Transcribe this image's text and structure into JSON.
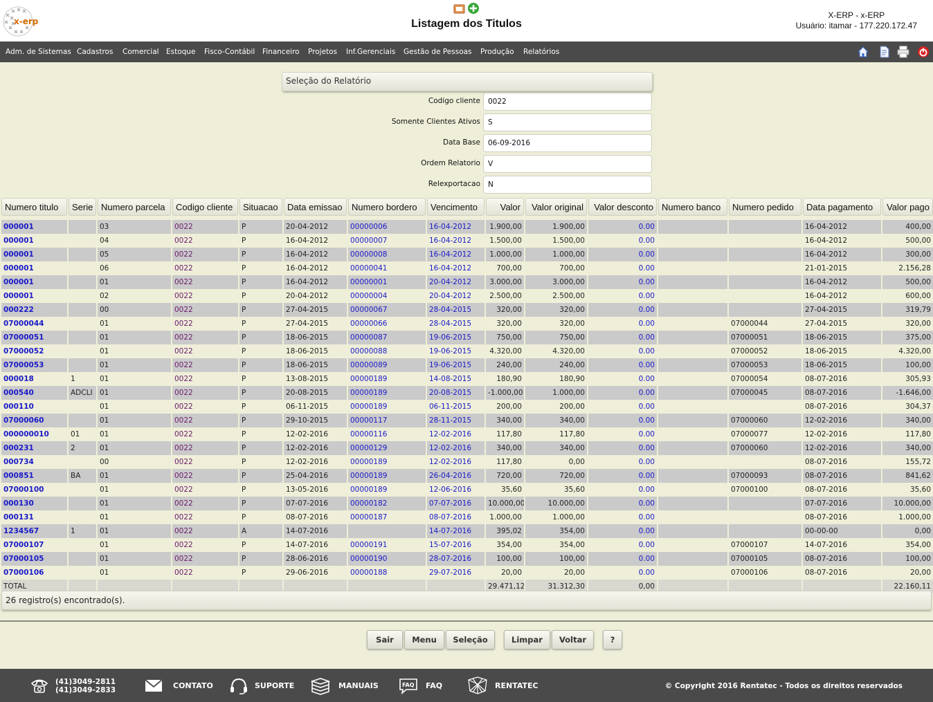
{
  "header": {
    "logo_text": "x-erp",
    "title": "Listagem dos Titulos",
    "system_name": "X-ERP - x-ERP",
    "user_info": "Usuário: itamar - 177.220.172.47"
  },
  "menu": {
    "items": [
      "Adm. de Sistemas",
      "Cadastros",
      "Comercial",
      "Estoque",
      "Fisco-Contábil",
      "Financeiro",
      "Projetos",
      "Inf.Gerenciais",
      "Gestão de Pessoas",
      "Produção",
      "Relatórios"
    ],
    "tools": [
      "home-icon",
      "document-icon",
      "printer-icon",
      "power-icon"
    ]
  },
  "selection": {
    "title": "Seleção do Relatório",
    "fields": [
      {
        "label": "Codigo cliente",
        "value": "0022"
      },
      {
        "label": "Somente Clientes Ativos",
        "value": "S"
      },
      {
        "label": "Data Base",
        "value": "06-09-2016"
      },
      {
        "label": "Ordem Relatorio",
        "value": "V"
      },
      {
        "label": "Relexportacao",
        "value": "N"
      }
    ]
  },
  "table": {
    "headers": [
      "Numero titulo",
      "Serie",
      "Numero parcela",
      "Codigo cliente",
      "Situacao",
      "Data emissao",
      "Numero bordero",
      "Vencimento",
      "Valor",
      "Valor original",
      "Valor desconto",
      "Numero banco",
      "Numero pedido",
      "Data pagamento",
      "Valor pago"
    ],
    "rows": [
      [
        "000001",
        "",
        "03",
        "0022",
        "P",
        "20-04-2012",
        "00000006",
        "16-04-2012",
        "1.900,00",
        "1.900,00",
        "0.00",
        "",
        "",
        "16-04-2012",
        "400,00"
      ],
      [
        "000001",
        "",
        "04",
        "0022",
        "P",
        "16-04-2012",
        "00000007",
        "16-04-2012",
        "1.500,00",
        "1.500,00",
        "0.00",
        "",
        "",
        "16-04-2012",
        "500,00"
      ],
      [
        "000001",
        "",
        "05",
        "0022",
        "P",
        "16-04-2012",
        "00000008",
        "16-04-2012",
        "1.000,00",
        "1.000,00",
        "0.00",
        "",
        "",
        "16-04-2012",
        "300,00"
      ],
      [
        "000001",
        "",
        "06",
        "0022",
        "P",
        "16-04-2012",
        "00000041",
        "16-04-2012",
        "700,00",
        "700,00",
        "0.00",
        "",
        "",
        "21-01-2015",
        "2.156,28"
      ],
      [
        "000001",
        "",
        "01",
        "0022",
        "P",
        "16-04-2012",
        "00000001",
        "20-04-2012",
        "3.000,00",
        "3.000,00",
        "0.00",
        "",
        "",
        "16-04-2012",
        "500,00"
      ],
      [
        "000001",
        "",
        "02",
        "0022",
        "P",
        "20-04-2012",
        "00000004",
        "20-04-2012",
        "2.500,00",
        "2.500,00",
        "0.00",
        "",
        "",
        "16-04-2012",
        "600,00"
      ],
      [
        "000222",
        "",
        "00",
        "0022",
        "P",
        "27-04-2015",
        "00000067",
        "28-04-2015",
        "320,00",
        "320,00",
        "0.00",
        "",
        "",
        "27-04-2015",
        "319,79"
      ],
      [
        "07000044",
        "",
        "01",
        "0022",
        "P",
        "27-04-2015",
        "00000066",
        "28-04-2015",
        "320,00",
        "320,00",
        "0.00",
        "",
        "07000044",
        "27-04-2015",
        "320,00"
      ],
      [
        "07000051",
        "",
        "01",
        "0022",
        "P",
        "18-06-2015",
        "00000087",
        "19-06-2015",
        "750,00",
        "750,00",
        "0.00",
        "",
        "07000051",
        "18-06-2015",
        "375,00"
      ],
      [
        "07000052",
        "",
        "01",
        "0022",
        "P",
        "18-06-2015",
        "00000088",
        "19-06-2015",
        "4.320,00",
        "4.320,00",
        "0.00",
        "",
        "07000052",
        "18-06-2015",
        "4.320,00"
      ],
      [
        "07000053",
        "",
        "01",
        "0022",
        "P",
        "18-06-2015",
        "00000089",
        "19-06-2015",
        "240,00",
        "240,00",
        "0.00",
        "",
        "07000053",
        "18-06-2015",
        "100,00"
      ],
      [
        "000018",
        "1",
        "01",
        "0022",
        "P",
        "13-08-2015",
        "00000189",
        "14-08-2015",
        "180,90",
        "180,90",
        "0.00",
        "",
        "07000054",
        "08-07-2016",
        "305,93"
      ],
      [
        "000540",
        "ADCLI",
        "01",
        "0022",
        "P",
        "20-08-2015",
        "00000189",
        "20-08-2015",
        "-1.000,00",
        "1.000,00",
        "0.00",
        "",
        "07000045",
        "08-07-2016",
        "-1.646,00"
      ],
      [
        "000110",
        "",
        "01",
        "0022",
        "P",
        "06-11-2015",
        "00000189",
        "06-11-2015",
        "200,00",
        "200,00",
        "0.00",
        "",
        "",
        "08-07-2016",
        "304,37"
      ],
      [
        "07000060",
        "",
        "01",
        "0022",
        "P",
        "29-10-2015",
        "00000117",
        "28-11-2015",
        "340,00",
        "340,00",
        "0.00",
        "",
        "07000060",
        "12-02-2016",
        "340,00"
      ],
      [
        "000000010",
        "01",
        "01",
        "0022",
        "P",
        "12-02-2016",
        "00000116",
        "12-02-2016",
        "117,80",
        "117,80",
        "0.00",
        "",
        "07000077",
        "12-02-2016",
        "117,80"
      ],
      [
        "000231",
        "2",
        "01",
        "0022",
        "P",
        "12-02-2016",
        "00000129",
        "12-02-2016",
        "340,00",
        "340,00",
        "0.00",
        "",
        "07000060",
        "12-02-2016",
        "340,00"
      ],
      [
        "000734",
        "",
        "00",
        "0022",
        "P",
        "12-02-2016",
        "00000189",
        "12-02-2016",
        "117,80",
        "0,00",
        "0.00",
        "",
        "",
        "08-07-2016",
        "155,72"
      ],
      [
        "000851",
        "BA",
        "01",
        "0022",
        "P",
        "25-04-2016",
        "00000189",
        "26-04-2016",
        "720,00",
        "720,00",
        "0.00",
        "",
        "07000093",
        "08-07-2016",
        "841,62"
      ],
      [
        "07000100",
        "",
        "01",
        "0022",
        "P",
        "13-05-2016",
        "00000189",
        "12-06-2016",
        "35,60",
        "35,60",
        "0.00",
        "",
        "07000100",
        "08-07-2016",
        "35,60"
      ],
      [
        "000130",
        "",
        "01",
        "0022",
        "P",
        "07-07-2016",
        "00000182",
        "07-07-2016",
        "10.000,00",
        "10.000,00",
        "0.00",
        "",
        "",
        "07-07-2016",
        "10.000,00"
      ],
      [
        "000131",
        "",
        "01",
        "0022",
        "P",
        "08-07-2016",
        "00000187",
        "08-07-2016",
        "1.000,00",
        "1.000,00",
        "0.00",
        "",
        "",
        "08-07-2016",
        "1.000,00"
      ],
      [
        "1234567",
        "1",
        "01",
        "0022",
        "A",
        "14-07-2016",
        "",
        "14-07-2016",
        "395,02",
        "354,00",
        "0.00",
        "",
        "",
        "00-00-00",
        "0,00"
      ],
      [
        "07000107",
        "",
        "01",
        "0022",
        "P",
        "14-07-2016",
        "00000191",
        "15-07-2016",
        "354,00",
        "354,00",
        "0.00",
        "",
        "07000107",
        "14-07-2016",
        "354,00"
      ],
      [
        "07000105",
        "",
        "01",
        "0022",
        "P",
        "28-06-2016",
        "00000190",
        "28-07-2016",
        "100,00",
        "100,00",
        "0.00",
        "",
        "07000105",
        "08-07-2016",
        "100,00"
      ],
      [
        "07000106",
        "",
        "01",
        "0022",
        "P",
        "29-06-2016",
        "00000188",
        "29-07-2016",
        "20,00",
        "20,00",
        "0.00",
        "",
        "07000106",
        "08-07-2016",
        "20,00"
      ]
    ],
    "total": {
      "label": "TOTAL",
      "valor": "29.471,12",
      "valor_original": "31.312,30",
      "valor_desconto": "0,00",
      "valor_pago": "22.160,11"
    }
  },
  "status": "26 registro(s) encontrado(s).",
  "buttons": {
    "sair": "Sair",
    "menu": "Menu",
    "selecao": "Seleção",
    "limpar": "Limpar",
    "voltar": "Voltar",
    "help": "?"
  },
  "footer": {
    "phone1": "(41)3049-2811",
    "phone2": "(41)3049-2833",
    "contato": "CONTATO",
    "suporte": "SUPORTE",
    "manuais": "MANUAIS",
    "faq": "FAQ",
    "rentatec": "RENTATEC",
    "copyright": "© Copyright 2016 Rentatec - Todos os direitos reservados"
  },
  "colors": {
    "background": "#efefd9",
    "bar": "#4a4a4a",
    "link": "#1a1ac8",
    "client_code": "#6a1a6a",
    "row_alt": "#cacaca"
  }
}
